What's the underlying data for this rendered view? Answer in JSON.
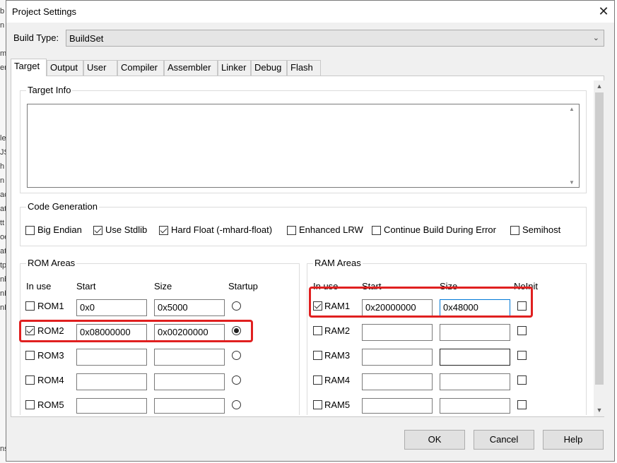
{
  "background_strip": [
    "b",
    "n",
    "m",
    "er",
    "le",
    "JS",
    "h",
    "n",
    "ac",
    "at",
    "tt",
    "oe",
    "at",
    "tp",
    "nb",
    "nL",
    "nE",
    "ns"
  ],
  "window": {
    "title": "Project Settings",
    "close_glyph": "✕"
  },
  "build_type": {
    "label": "Build Type:",
    "value": "BuildSet",
    "chevron": "⌄"
  },
  "tabs": [
    "Target",
    "Output",
    "User",
    "Compiler",
    "Assembler",
    "Linker",
    "Debug",
    "Flash"
  ],
  "active_tab": "Target",
  "target_info": {
    "title": "Target Info",
    "value": ""
  },
  "code_generation": {
    "title": "Code Generation",
    "options": [
      {
        "label": "Big Endian",
        "checked": false
      },
      {
        "label": "Use Stdlib",
        "checked": true
      },
      {
        "label": "Hard Float (-mhard-float)",
        "checked": true
      },
      {
        "label": "Enhanced LRW",
        "checked": false
      },
      {
        "label": "Continue Build During Error",
        "checked": false
      },
      {
        "label": "Semihost",
        "checked": false
      }
    ]
  },
  "rom_areas": {
    "title": "ROM Areas",
    "headers": {
      "in_use": "In use",
      "start": "Start",
      "size": "Size",
      "startup": "Startup"
    },
    "rows": [
      {
        "name": "ROM1",
        "in_use": false,
        "start": "0x0",
        "size": "0x5000",
        "startup": false
      },
      {
        "name": "ROM2",
        "in_use": true,
        "start": "0x08000000",
        "size": "0x00200000",
        "startup": true
      },
      {
        "name": "ROM3",
        "in_use": false,
        "start": "",
        "size": "",
        "startup": false
      },
      {
        "name": "ROM4",
        "in_use": false,
        "start": "",
        "size": "",
        "startup": false
      },
      {
        "name": "ROM5",
        "in_use": false,
        "start": "",
        "size": "",
        "startup": false
      }
    ]
  },
  "ram_areas": {
    "title": "RAM Areas",
    "headers": {
      "in_use": "In use",
      "start": "Start",
      "size": "Size",
      "noinit": "NoInit"
    },
    "rows": [
      {
        "name": "RAM1",
        "in_use": true,
        "start": "0x20000000",
        "size": "0x48000",
        "noinit": false
      },
      {
        "name": "RAM2",
        "in_use": false,
        "start": "",
        "size": "",
        "noinit": false
      },
      {
        "name": "RAM3",
        "in_use": false,
        "start": "",
        "size": "",
        "noinit": false
      },
      {
        "name": "RAM4",
        "in_use": false,
        "start": "",
        "size": "",
        "noinit": false
      },
      {
        "name": "RAM5",
        "in_use": false,
        "start": "",
        "size": "",
        "noinit": false
      }
    ]
  },
  "scroll": {
    "up": "▲",
    "down": "▼"
  },
  "buttons": {
    "ok": "OK",
    "cancel": "Cancel",
    "help": "Help"
  },
  "colors": {
    "highlight": "#e02020",
    "dialog_bg": "#f0f0f0",
    "focus_border": "#0078d7"
  }
}
